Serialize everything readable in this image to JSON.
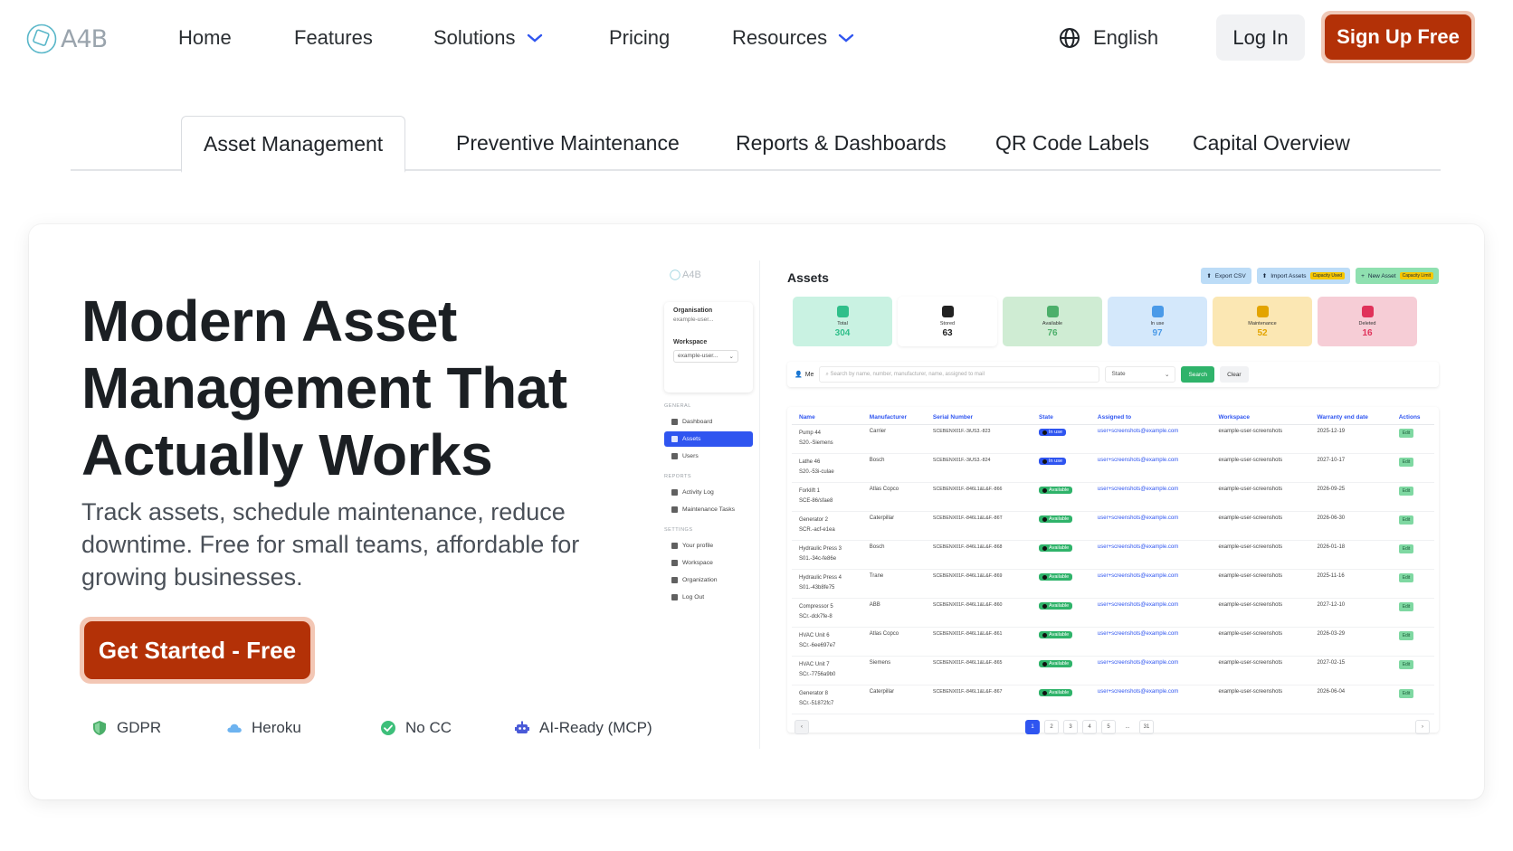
{
  "brand": {
    "logo_text": "A4B"
  },
  "nav": {
    "home": "Home",
    "features": "Features",
    "solutions": "Solutions",
    "pricing": "Pricing",
    "resources": "Resources",
    "language": "English",
    "login": "Log In",
    "signup": "Sign Up Free"
  },
  "tabs": [
    "Asset Management",
    "Preventive Maintenance",
    "Reports & Dashboards",
    "QR Code Labels",
    "Capital Overview"
  ],
  "hero": {
    "title_line1": "Modern Asset",
    "title_line2": "Management That",
    "title_line3": "Actually Works",
    "subtitle": "Track assets, schedule maintenance, reduce downtime. Free for small teams, affordable for growing businesses.",
    "cta": "Get Started - Free"
  },
  "badges": [
    "GDPR",
    "Heroku",
    "No CC",
    "AI-Ready (MCP)"
  ],
  "colors": {
    "brand": "#b33107",
    "accent_blue": "#2f55f0",
    "available_green": "#2fb36a"
  },
  "mockup": {
    "sidebar": {
      "logo": "A4B",
      "org_label": "Organisation",
      "org_value": "example-user...",
      "ws_label": "Workspace",
      "ws_value": "example-user...",
      "section_general": "GENERAL",
      "dashboard": "Dashboard",
      "assets": "Assets",
      "users": "Users",
      "section_reports": "REPORTS",
      "activity": "Activity Log",
      "tasks": "Maintenance Tasks",
      "section_settings": "SETTINGS",
      "profile": "Your profile",
      "workspace": "Workspace",
      "organization": "Organization",
      "logout": "Log Out"
    },
    "title": "Assets",
    "actions": {
      "export": "Export CSV",
      "import": "Import Assets",
      "import_tag": "Capacity Used",
      "new": "New Asset",
      "new_tag": "Capacity Limit"
    },
    "stats": [
      {
        "label": "Total",
        "value": "304",
        "bg": "#c9f2e2",
        "fg": "#2fbf8a"
      },
      {
        "label": "Stored",
        "value": "63",
        "bg": "#ffffff",
        "fg": "#222222"
      },
      {
        "label": "Available",
        "value": "76",
        "bg": "#cfecd3",
        "fg": "#4caf6a"
      },
      {
        "label": "In use",
        "value": "97",
        "bg": "#d4e8fb",
        "fg": "#4a9ae8"
      },
      {
        "label": "Maintenance",
        "value": "52",
        "bg": "#fbe7b3",
        "fg": "#e3a400"
      },
      {
        "label": "Deleted",
        "value": "16",
        "bg": "#f6cdd6",
        "fg": "#e0325a"
      }
    ],
    "filter": {
      "me": "Me",
      "search_placeholder": "Search by name, number, manufacturer, name, assigned to mail",
      "state": "State",
      "search": "Search",
      "clear": "Clear"
    },
    "columns": [
      "Name",
      "Manufacturer",
      "Serial Number",
      "State",
      "Assigned to",
      "Workspace",
      "Warranty end date",
      "Actions"
    ],
    "rows": [
      {
        "name": "Pump 44",
        "sub": "S20.-Siemens",
        "mfr": "Carrier",
        "serial": "SCEBENX01F.-3iUS3.-823",
        "state": "In use",
        "mail": "user+screenshots@example.com",
        "ws": "example-user-screenshots",
        "date": "2025-12-19"
      },
      {
        "name": "Lathe 46",
        "sub": "S20.-53i-culae",
        "mfr": "Bosch",
        "serial": "SCEBENX01F.-3iUS3.-824",
        "state": "In use",
        "mail": "user+screenshots@example.com",
        "ws": "example-user-screenshots",
        "date": "2027-10-17"
      },
      {
        "name": "Forklift 1",
        "sub": "SCE-86/sfae8",
        "mfr": "Atlas Copco",
        "serial": "SCEBENX01F.-846L1&L&F.-866",
        "state": "Available",
        "mail": "user+screenshots@example.com",
        "ws": "example-user-screenshots",
        "date": "2026-09-25"
      },
      {
        "name": "Generator 2",
        "sub": "SCR.-acf-e1ea",
        "mfr": "Caterpillar",
        "serial": "SCEBENX01F.-846L1&L&F.-86T",
        "state": "Available",
        "mail": "user+screenshots@example.com",
        "ws": "example-user-screenshots",
        "date": "2026-06-30"
      },
      {
        "name": "Hydraulic Press 3",
        "sub": "S01.-34c-fe86e",
        "mfr": "Bosch",
        "serial": "SCEBENX01F.-846L1&L&F.-868",
        "state": "Available",
        "mail": "user+screenshots@example.com",
        "ws": "example-user-screenshots",
        "date": "2026-01-18"
      },
      {
        "name": "Hydraulic Press 4",
        "sub": "S01.-43b8fe75",
        "mfr": "Trane",
        "serial": "SCEBENX01F.-846L1&L&F.-869",
        "state": "Available",
        "mail": "user+screenshots@example.com",
        "ws": "example-user-screenshots",
        "date": "2025-11-16"
      },
      {
        "name": "Compressor 5",
        "sub": "SCr.-dck7fe-8",
        "mfr": "ABB",
        "serial": "SCEBENX01F.-846L1&L&F.-860",
        "state": "Available",
        "mail": "user+screenshots@example.com",
        "ws": "example-user-screenshots",
        "date": "2027-12-10"
      },
      {
        "name": "HVAC Unit 6",
        "sub": "SCr.-6ee697e7",
        "mfr": "Atlas Copco",
        "serial": "SCEBENX01F.-846L1&L&F.-861",
        "state": "Available",
        "mail": "user+screenshots@example.com",
        "ws": "example-user-screenshots",
        "date": "2026-03-29"
      },
      {
        "name": "HVAC Unit 7",
        "sub": "SCr.-7756a9b0",
        "mfr": "Siemens",
        "serial": "SCEBENX01F.-846L1&L&F.-865",
        "state": "Available",
        "mail": "user+screenshots@example.com",
        "ws": "example-user-screenshots",
        "date": "2027-02-15"
      },
      {
        "name": "Generator 8",
        "sub": "SCr.-51872fc7",
        "mfr": "Caterpillar",
        "serial": "SCEBENX01F.-846L1&L&F.-867",
        "state": "Available",
        "mail": "user+screenshots@example.com",
        "ws": "example-user-screenshots",
        "date": "2026-06-04"
      }
    ],
    "edit_label": "Edit",
    "pager": {
      "prev": "‹",
      "pages": [
        "1",
        "2",
        "3",
        "4",
        "5",
        "...",
        "31"
      ],
      "next": "›"
    }
  }
}
